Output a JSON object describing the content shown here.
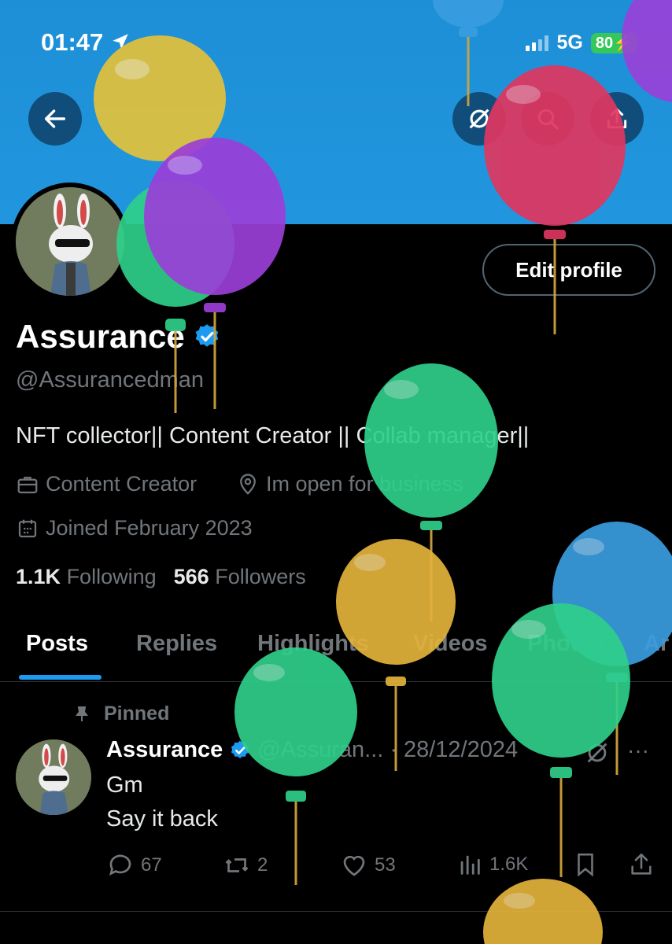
{
  "status_bar": {
    "time": "01:47",
    "network": "5G",
    "battery": "80"
  },
  "header": {
    "back_icon": "arrow-left-icon",
    "refresh_icon": "refresh-off-icon",
    "search_icon": "search-icon",
    "share_icon": "share-icon"
  },
  "profile": {
    "edit_label": "Edit profile",
    "name": "Assurance",
    "handle": "@Assurancedman",
    "bio": "NFT collector|| Content Creator || Collab manager||",
    "category": "Content Creator",
    "location": "Im open for business",
    "joined": "Joined February 2023",
    "following_count": "1.1K",
    "following_label": "Following",
    "followers_count": "566",
    "followers_label": "Followers"
  },
  "tabs": [
    "Posts",
    "Replies",
    "Highlights",
    "Videos",
    "Photos",
    "Ar"
  ],
  "tweet": {
    "pinned_label": "Pinned",
    "name": "Assurance",
    "handle": "@Assuran...",
    "separator": "·",
    "date": "28/12/2024",
    "more": "···",
    "line1": "Gm",
    "line2": "Say it back",
    "replies": "67",
    "retweets": "2",
    "likes": "53",
    "views": "1.6K"
  },
  "colors": {
    "accent": "#1d9bf0",
    "banner": "#1d8fd6",
    "background": "#000000",
    "muted": "#71767b"
  }
}
